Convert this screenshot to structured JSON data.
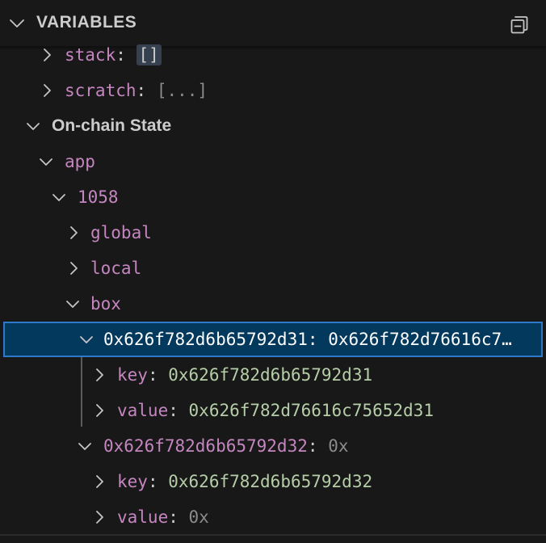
{
  "header": {
    "title": "VARIABLES",
    "collapse_icon": "collapse-all-icon",
    "chevron_icon": "chevron-down-icon"
  },
  "tree": {
    "stack": {
      "name": "stack",
      "colon": ":",
      "value": "[]"
    },
    "scratch": {
      "name": "scratch",
      "colon": ":",
      "value": "[...]"
    },
    "onchain": {
      "label": "On-chain State"
    },
    "app": {
      "name": "app"
    },
    "appid": {
      "name": "1058"
    },
    "global": {
      "name": "global"
    },
    "local": {
      "name": "local"
    },
    "box": {
      "name": "box"
    },
    "box1": {
      "name": "0x626f782d6b65792d31",
      "colon": ":",
      "value": "0x626f782d76616c7…",
      "key": {
        "name": "key",
        "colon": ":",
        "value": "0x626f782d6b65792d31"
      },
      "val": {
        "name": "value",
        "colon": ":",
        "value": "0x626f782d76616c75652d31"
      }
    },
    "box2": {
      "name": "0x626f782d6b65792d32",
      "colon": ":",
      "value": "0x",
      "key": {
        "name": "key",
        "colon": ":",
        "value": "0x626f782d6b65792d32"
      },
      "val": {
        "name": "value",
        "colon": ":",
        "value": "0x"
      }
    }
  },
  "colors": {
    "background": "#181818",
    "name": "#c586c0",
    "value_gray": "#8b8b8b",
    "value_green": "#b5cea8",
    "selection_bg": "#04395e",
    "selection_border": "#2f79c9"
  }
}
